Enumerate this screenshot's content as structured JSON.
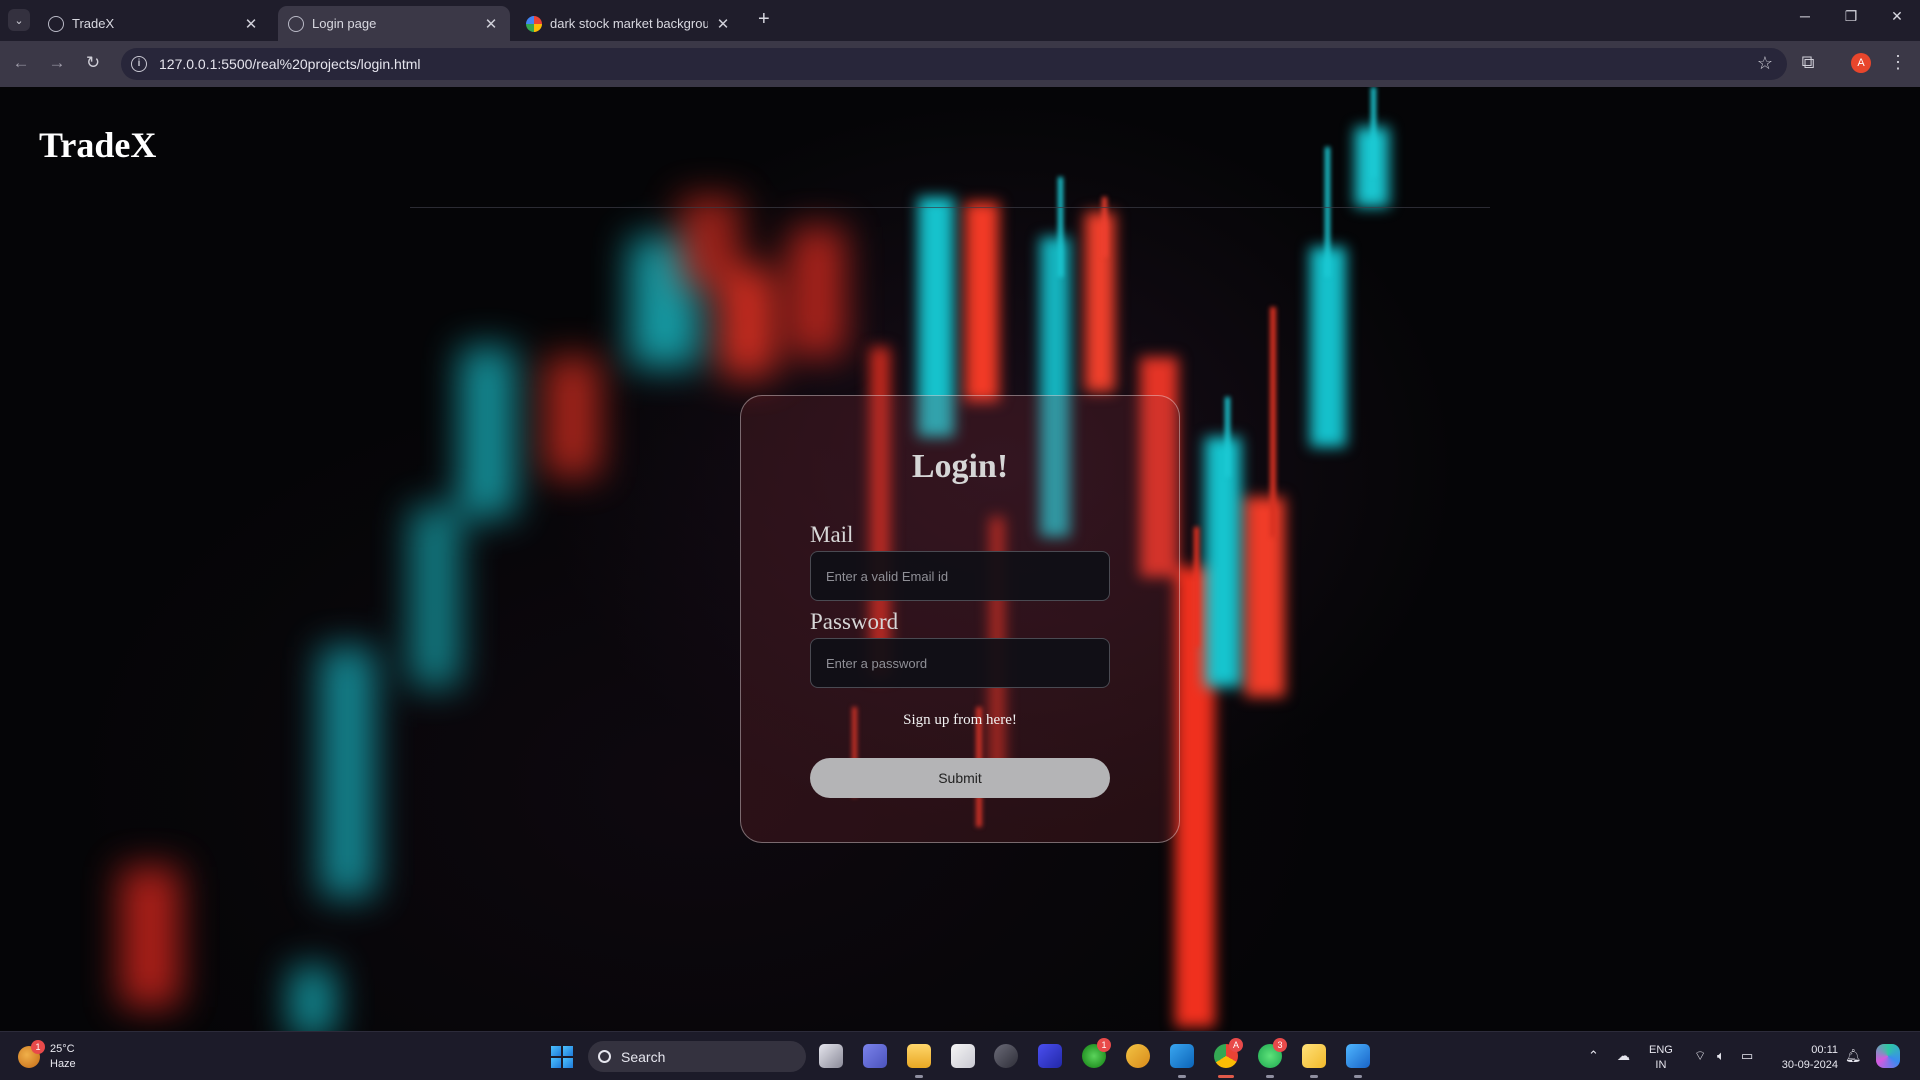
{
  "browser": {
    "tabs": [
      {
        "label": "TradeX",
        "active": false,
        "icon": "globe-icon"
      },
      {
        "label": "Login page",
        "active": true,
        "icon": "globe-icon"
      },
      {
        "label": "dark stock market background",
        "active": false,
        "icon": "google-icon"
      }
    ],
    "url": "127.0.0.1:5500/real%20projects/login.html",
    "profile_initial": "A"
  },
  "page": {
    "brand": "TradeX",
    "login": {
      "title": "Login!",
      "mail_label": "Mail",
      "mail_placeholder": "Enter a valid Email id",
      "password_label": "Password",
      "password_placeholder": "Enter a password",
      "signup_link": "Sign up from here!",
      "submit_label": "Submit"
    }
  },
  "taskbar": {
    "weather": {
      "temp": "25°C",
      "condition": "Haze",
      "badge": "1"
    },
    "search_label": "Search",
    "apps": [
      {
        "name": "task-view",
        "badge": ""
      },
      {
        "name": "teams",
        "badge": ""
      },
      {
        "name": "file-explorer",
        "badge": ""
      },
      {
        "name": "microsoft-store",
        "badge": ""
      },
      {
        "name": "github-desktop",
        "badge": ""
      },
      {
        "name": "azure-data-studio",
        "badge": ""
      },
      {
        "name": "xbox",
        "badge": "1"
      },
      {
        "name": "medal",
        "badge": ""
      },
      {
        "name": "vscode",
        "badge": ""
      },
      {
        "name": "chrome",
        "badge": "A"
      },
      {
        "name": "whatsapp",
        "badge": "3"
      },
      {
        "name": "sticky-notes",
        "badge": ""
      },
      {
        "name": "photo-editor",
        "badge": ""
      }
    ],
    "lang": {
      "line1": "ENG",
      "line2": "IN"
    },
    "time": "00:11",
    "date": "30-09-2024"
  },
  "colors": {
    "accent_red": "#e8462c",
    "candle_red": "#ff3b2a",
    "candle_teal": "#16c8d0"
  }
}
